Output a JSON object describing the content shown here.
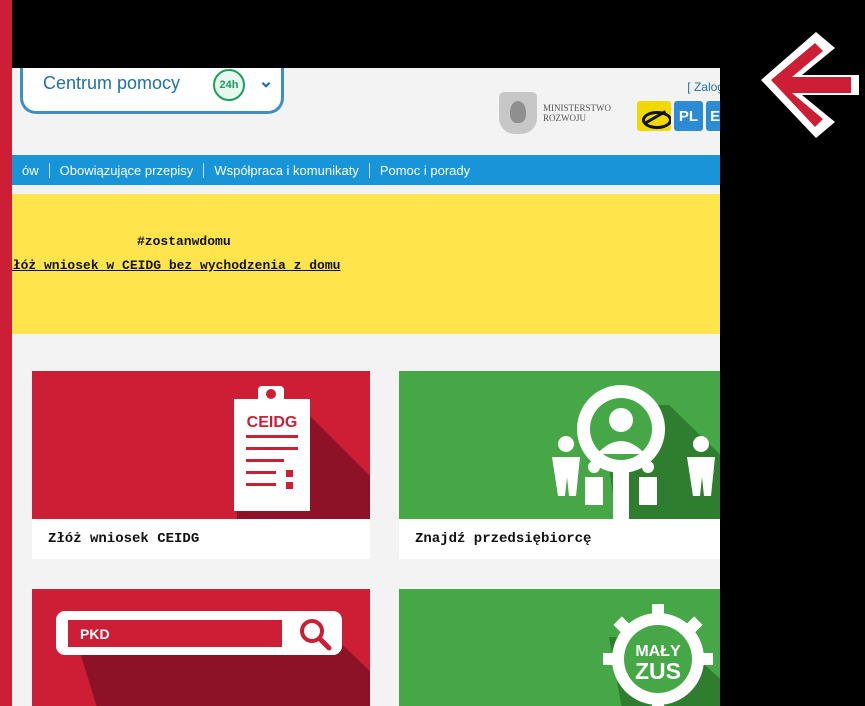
{
  "header": {
    "help_label": "Centrum pomocy",
    "help_badge": "24h",
    "login": "[ Zaloguj ]",
    "ministry_line1": "MINISTERSTWO",
    "ministry_line2": "ROZWOJU",
    "lang_pl": "PL",
    "lang_en": "EN"
  },
  "nav": {
    "items": [
      {
        "label": "ów"
      },
      {
        "label": "Obowiązujące przepisy"
      },
      {
        "label": "Współpraca i komunikaty"
      },
      {
        "label": "Pomoc i porady"
      }
    ]
  },
  "banner": {
    "hashtag": "#zostanwdomu",
    "link": "Złóż wniosek w CEIDG bez wychodzenia z domu"
  },
  "tiles": [
    {
      "label": "Złóż wniosek CEIDG",
      "image_text": "CEIDG"
    },
    {
      "label": "Znajdź przedsiębiorcę"
    },
    {
      "image_text": "PKD"
    },
    {
      "image_text_line1": "MAŁY",
      "image_text_line2": "ZUS"
    }
  ],
  "colors": {
    "red": "#cc1f36",
    "green": "#45a745",
    "blue": "#1895d8",
    "yellow": "#ffe54b"
  },
  "icons": [
    "24h-help-icon",
    "chevron-down-icon",
    "ministry-eagle-icon",
    "accessibility-eye-icon",
    "clipboard-icon",
    "search-person-icon",
    "magnifier-icon",
    "gear-icon",
    "left-arrow-icon"
  ]
}
